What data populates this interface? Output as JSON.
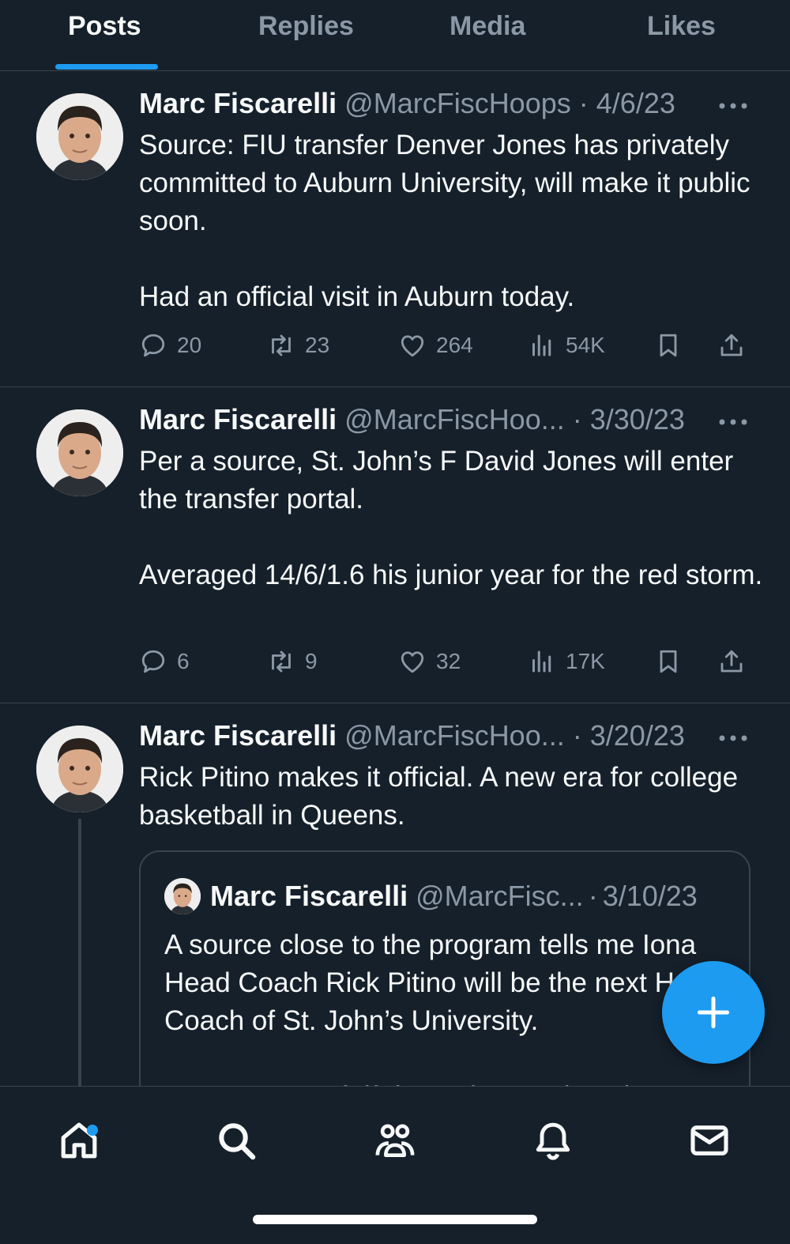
{
  "tabs": [
    {
      "label": "Posts",
      "active": true
    },
    {
      "label": "Replies",
      "active": false
    },
    {
      "label": "Media",
      "active": false
    },
    {
      "label": "Likes",
      "active": false
    }
  ],
  "posts": [
    {
      "name": "Marc Fiscarelli",
      "handle": "@MarcFiscHoops",
      "date": "4/6/23",
      "text": "Source: FIU transfer Denver Jones has privately committed to Auburn University, will make it public soon.\n\nHad an official visit in Auburn today.",
      "replies": "20",
      "reposts": "23",
      "likes": "264",
      "views": "54K"
    },
    {
      "name": "Marc Fiscarelli",
      "handle": "@MarcFiscHoo...",
      "date": "3/30/23",
      "text": "Per a source, St. John’s F David Jones will enter the transfer portal.\n\nAveraged 14/6/1.6 his junior year for the red storm.",
      "replies": "6",
      "reposts": "9",
      "likes": "32",
      "views": "17K"
    },
    {
      "name": "Marc Fiscarelli",
      "handle": "@MarcFiscHoo...",
      "date": "3/20/23",
      "text": "Rick Pitino makes it official. A new era for college basketball in Queens.",
      "quote": {
        "name": "Marc Fiscarelli",
        "handle": "@MarcFisc...",
        "date": "3/10/23",
        "text": "A source close to the program tells me Iona Head Coach Rick Pitino will be the next Head Coach of St. John’s University.\n\nNot a matter of “if” but “when”. It is a done deal."
      }
    }
  ],
  "separator": "·",
  "icons": {
    "reply": "reply-icon",
    "repost": "repost-icon",
    "like": "heart-icon",
    "views": "views-icon",
    "bookmark": "bookmark-icon",
    "share": "share-icon",
    "more": "more-icon",
    "compose": "plus-icon",
    "nav": [
      "home-icon",
      "search-icon",
      "communities-icon",
      "notifications-icon",
      "messages-icon"
    ]
  },
  "colors": {
    "background": "#15202b",
    "accent": "#1d9bf0",
    "text": "#f7f9f9",
    "muted": "#8b98a5",
    "border": "#38444d"
  }
}
